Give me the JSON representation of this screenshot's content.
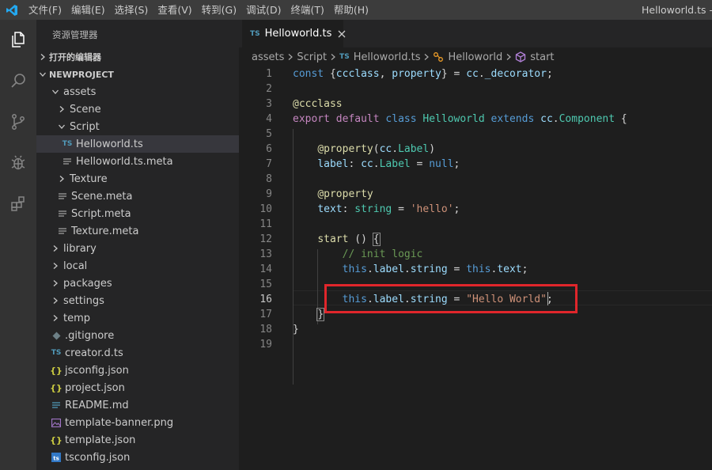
{
  "titlebar": {
    "menus": [
      "文件(F)",
      "编辑(E)",
      "选择(S)",
      "查看(V)",
      "转到(G)",
      "调试(D)",
      "终端(T)",
      "帮助(H)"
    ],
    "window_title": "Helloworld.ts - N"
  },
  "activity_bar": {
    "icons": [
      "explorer-icon",
      "search-icon",
      "source-control-icon",
      "debug-icon",
      "extensions-icon"
    ]
  },
  "sidebar": {
    "title": "资源管理器",
    "open_editors_label": "打开的编辑器",
    "project_label": "NEWPROJECT",
    "tree": [
      {
        "label": "assets",
        "type": "folder-open",
        "depth": 1
      },
      {
        "label": "Scene",
        "type": "folder",
        "depth": 2
      },
      {
        "label": "Script",
        "type": "folder-open",
        "depth": 2
      },
      {
        "label": "Helloworld.ts",
        "type": "ts",
        "depth": 3,
        "selected": true
      },
      {
        "label": "Helloworld.ts.meta",
        "type": "meta",
        "depth": 3
      },
      {
        "label": "Texture",
        "type": "folder",
        "depth": 2
      },
      {
        "label": "Scene.meta",
        "type": "meta",
        "depth": 2
      },
      {
        "label": "Script.meta",
        "type": "meta",
        "depth": 2
      },
      {
        "label": "Texture.meta",
        "type": "meta",
        "depth": 2
      },
      {
        "label": "library",
        "type": "folder",
        "depth": 1
      },
      {
        "label": "local",
        "type": "folder",
        "depth": 1
      },
      {
        "label": "packages",
        "type": "folder",
        "depth": 1
      },
      {
        "label": "settings",
        "type": "folder",
        "depth": 1
      },
      {
        "label": "temp",
        "type": "folder",
        "depth": 1
      },
      {
        "label": ".gitignore",
        "type": "git",
        "depth": 1
      },
      {
        "label": "creator.d.ts",
        "type": "ts",
        "depth": 1
      },
      {
        "label": "jsconfig.json",
        "type": "json",
        "depth": 1
      },
      {
        "label": "project.json",
        "type": "json",
        "depth": 1
      },
      {
        "label": "README.md",
        "type": "md",
        "depth": 1
      },
      {
        "label": "template-banner.png",
        "type": "png",
        "depth": 1
      },
      {
        "label": "template.json",
        "type": "json",
        "depth": 1
      },
      {
        "label": "tsconfig.json",
        "type": "tsconfig",
        "depth": 1
      }
    ]
  },
  "editor": {
    "tab_label": "Helloworld.ts",
    "tab_badge": "TS",
    "breadcrumb": {
      "folder1": "assets",
      "folder2": "Script",
      "file": "Helloworld.ts",
      "class": "Helloworld",
      "method": "start"
    },
    "line_numbers": [
      "1",
      "2",
      "3",
      "4",
      "5",
      "6",
      "7",
      "8",
      "9",
      "10",
      "11",
      "12",
      "13",
      "14",
      "15",
      "16",
      "17",
      "18",
      "19"
    ]
  },
  "colors": {
    "highlight_border": "#e0262b",
    "accent_blue": "#007acc"
  }
}
